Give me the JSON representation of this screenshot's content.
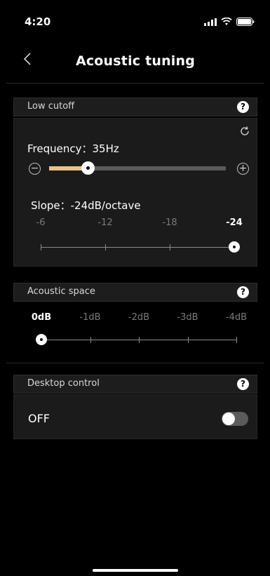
{
  "status_bar": {
    "time": "4:20"
  },
  "header": {
    "back_icon": "chevron-left-icon",
    "title": "Acoustic tuning"
  },
  "low_cutoff": {
    "section_label": "Low cutoff",
    "help_label": "?",
    "refresh_icon": "refresh-icon",
    "frequency_label": "Frequency：35Hz",
    "frequency_fraction": 0.22,
    "minus_label": "−",
    "plus_label": "+",
    "slope_label": "Slope：-24dB/octave",
    "slope_ticks": [
      "-6",
      "-12",
      "-18",
      "-24"
    ],
    "slope_selected_index": 3
  },
  "acoustic_space": {
    "section_label": "Acoustic space",
    "help_label": "?",
    "ticks": [
      "0dB",
      "-1dB",
      "-2dB",
      "-3dB",
      "-4dB"
    ],
    "selected_index": 0
  },
  "desktop_control": {
    "section_label": "Desktop control",
    "help_label": "?",
    "state_label": "OFF",
    "toggle_on": false
  },
  "colors": {
    "background": "#000000",
    "accent": "#e7c288",
    "card": "#1b1b1b"
  }
}
